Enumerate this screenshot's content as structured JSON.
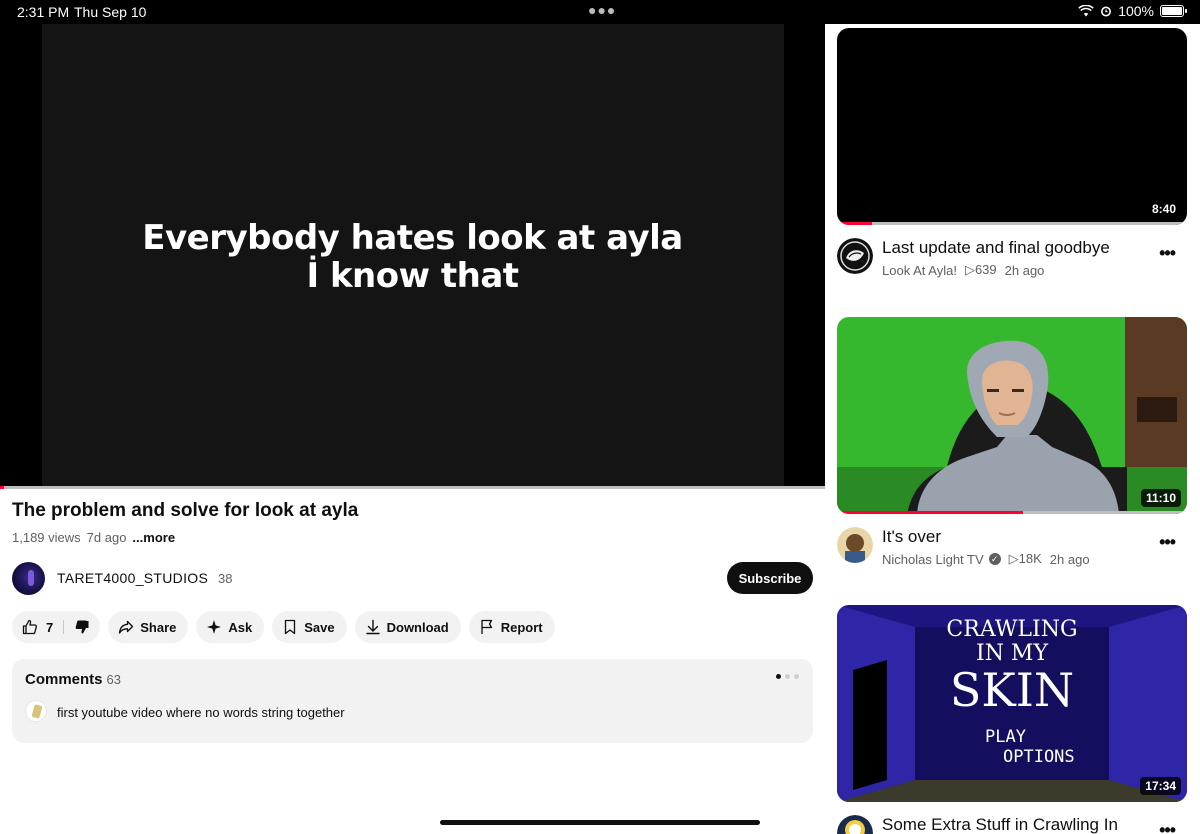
{
  "status_bar": {
    "time": "2:31 PM",
    "date": "Thu Sep 10",
    "battery": "100%"
  },
  "player": {
    "caption_line1": "Everybody hates look at ayla",
    "caption_line2": "İ know that",
    "progress": 0.005
  },
  "video": {
    "title": "The problem and solve for look at ayla",
    "views": "1,189 views",
    "age": "7d ago",
    "more": "...more",
    "channel": {
      "name": "TARET4000_STUDIOS",
      "subscribers": "38",
      "subscribe_label": "Subscribe"
    }
  },
  "actions": {
    "likes": "7",
    "share": "Share",
    "ask": "Ask",
    "save": "Save",
    "download": "Download",
    "report": "Report"
  },
  "comments": {
    "label": "Comments",
    "count": "63",
    "top_comment": "first youtube video where no words string together"
  },
  "recommendations": [
    {
      "title": "Last update and final goodbye",
      "channel": "Look At Ayla!",
      "views": "639",
      "age": "2h ago",
      "duration": "8:40",
      "progress": 0.1,
      "verified": false
    },
    {
      "title": "It's over",
      "channel": "Nicholas Light TV",
      "views": "18K",
      "age": "2h ago",
      "duration": "11:10",
      "progress": 0.53,
      "verified": true
    },
    {
      "title": "Some Extra Stuff in Crawling In",
      "duration": "17:34",
      "thumb_text": {
        "line1": "CRAWLING",
        "line2": "IN MY",
        "line3": "SKIN",
        "line4": "PLAY",
        "line5": "OPTIONS"
      }
    }
  ],
  "colors": {
    "accent_red": "#ff0033",
    "pill_bg": "#f2f2f2",
    "text": "#0f0f0f",
    "muted": "#606060"
  }
}
